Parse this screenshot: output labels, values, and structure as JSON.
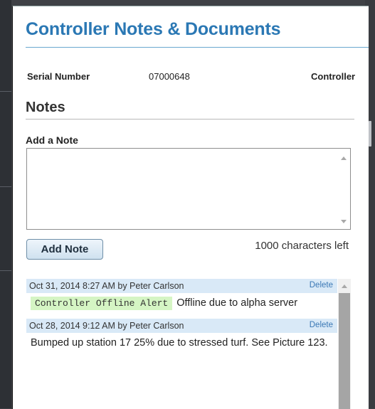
{
  "dialog": {
    "title": "Controller Notes & Documents",
    "serial_label": "Serial Number",
    "serial_value": "07000648",
    "controller_label": "Controller"
  },
  "notes_section": {
    "heading": "Notes",
    "add_label": "Add a Note",
    "input_value": "",
    "add_button": "Add Note",
    "chars_left": "1000 characters left"
  },
  "notes": [
    {
      "meta": "Oct 31, 2014 8:27 AM by Peter Carlson",
      "delete": "Delete",
      "tag": "Controller Offline Alert",
      "text": "Offline due to alpha server"
    },
    {
      "meta": "Oct 28, 2014 9:12 AM by Peter Carlson",
      "delete": "Delete",
      "tag": "",
      "text": "Bumped up station 17 25% due to stressed turf. See Picture 123."
    }
  ],
  "colors": {
    "title": "#2b78b4",
    "note_header_bg": "#d9e9f7",
    "alert_tag_bg": "#d5f5c4",
    "delete_link": "#3a78b5"
  }
}
